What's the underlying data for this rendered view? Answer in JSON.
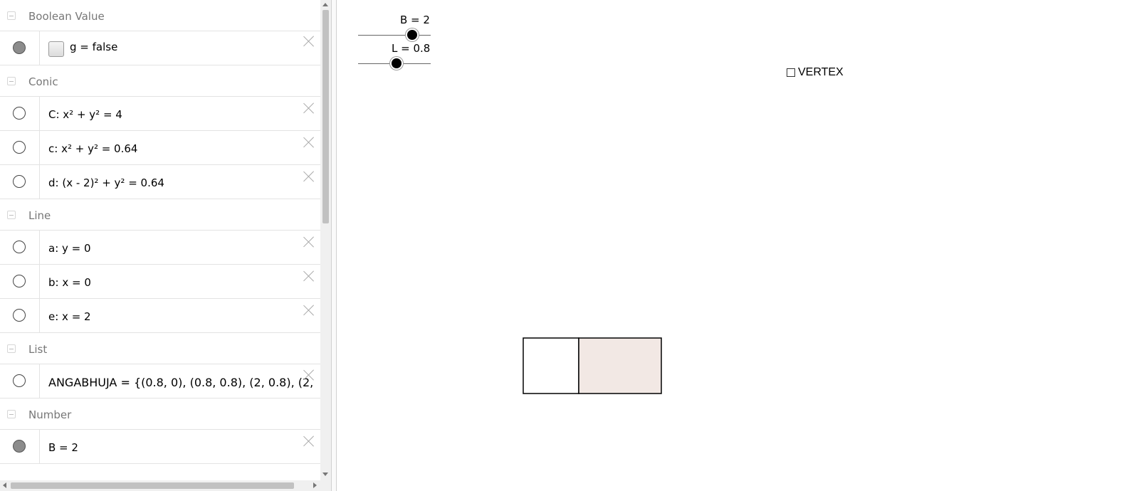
{
  "algebra": {
    "groups": [
      {
        "title": "Boolean Value",
        "items": [
          {
            "expr": "g = false",
            "marble_on": true,
            "has_checkbox": true
          }
        ]
      },
      {
        "title": "Conic",
        "items": [
          {
            "expr": "C: x² + y² = 4",
            "marble_on": false
          },
          {
            "expr": "c: x² + y² = 0.64",
            "marble_on": false
          },
          {
            "expr": "d: (x - 2)² + y² = 0.64",
            "marble_on": false
          }
        ]
      },
      {
        "title": "Line",
        "items": [
          {
            "expr": "a: y = 0",
            "marble_on": false
          },
          {
            "expr": "b: x = 0",
            "marble_on": false
          },
          {
            "expr": "e: x = 2",
            "marble_on": false
          }
        ]
      },
      {
        "title": "List",
        "items": [
          {
            "expr": "ANGABHUJA = {(0.8, 0), (0.8, 0.8), (2, 0.8), (2,",
            "marble_on": false
          }
        ]
      },
      {
        "title": "Number",
        "items": [
          {
            "expr": "B = 2",
            "marble_on": true
          }
        ]
      }
    ]
  },
  "graphics": {
    "sliders": [
      {
        "label": "B = 2",
        "value": 2,
        "min": 0,
        "max": 2.7
      },
      {
        "label": "L = 0.8",
        "value": 0.8,
        "min": 0,
        "max": 1.5
      }
    ],
    "checkbox": {
      "label": "VERTEX",
      "checked": false
    },
    "fill_color": "#f2e8e4",
    "stroke_color": "#000000"
  }
}
